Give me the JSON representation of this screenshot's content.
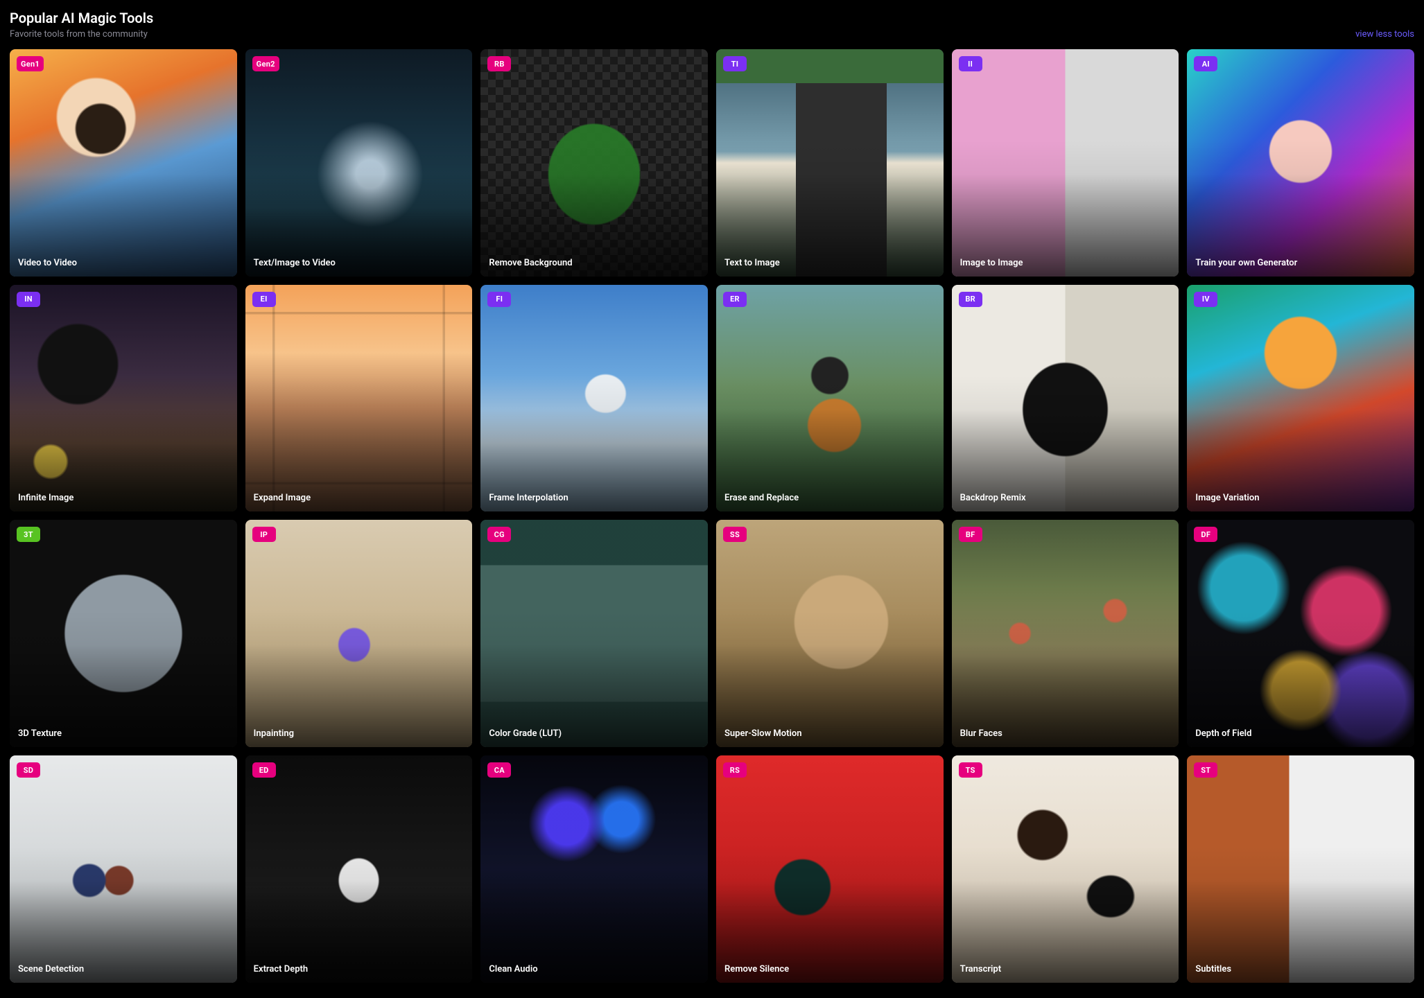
{
  "header": {
    "title": "Popular AI Magic Tools",
    "subtitle": "Favorite tools from the community",
    "toggle_label": "view less tools"
  },
  "badge_colors": {
    "pink": "#e6007e",
    "purple": "#7b2ff2",
    "green": "#58c322"
  },
  "tools": [
    {
      "badge": "Gen1",
      "badge_color": "pink",
      "label": "Video to Video",
      "thumb_class": "t-gen1"
    },
    {
      "badge": "Gen2",
      "badge_color": "pink",
      "label": "Text/Image to Video",
      "thumb_class": "t-gen2"
    },
    {
      "badge": "RB",
      "badge_color": "pink",
      "label": "Remove Background",
      "thumb_class": "t-rb"
    },
    {
      "badge": "TI",
      "badge_color": "purple",
      "label": "Text to Image",
      "thumb_class": "t-ti"
    },
    {
      "badge": "II",
      "badge_color": "purple",
      "label": "Image to Image",
      "thumb_class": "t-ii"
    },
    {
      "badge": "AI",
      "badge_color": "purple",
      "label": "Train your own Generator",
      "thumb_class": "t-ai"
    },
    {
      "badge": "IN",
      "badge_color": "purple",
      "label": "Infinite Image",
      "thumb_class": "t-in"
    },
    {
      "badge": "EI",
      "badge_color": "purple",
      "label": "Expand Image",
      "thumb_class": "t-ei"
    },
    {
      "badge": "FI",
      "badge_color": "purple",
      "label": "Frame Interpolation",
      "thumb_class": "t-fi"
    },
    {
      "badge": "ER",
      "badge_color": "purple",
      "label": "Erase and Replace",
      "thumb_class": "t-er"
    },
    {
      "badge": "BR",
      "badge_color": "purple",
      "label": "Backdrop Remix",
      "thumb_class": "t-br"
    },
    {
      "badge": "IV",
      "badge_color": "purple",
      "label": "Image Variation",
      "thumb_class": "t-iv"
    },
    {
      "badge": "3T",
      "badge_color": "green",
      "label": "3D Texture",
      "thumb_class": "t-3t"
    },
    {
      "badge": "IP",
      "badge_color": "pink",
      "label": "Inpainting",
      "thumb_class": "t-ip"
    },
    {
      "badge": "CG",
      "badge_color": "pink",
      "label": "Color Grade (LUT)",
      "thumb_class": "t-cg"
    },
    {
      "badge": "SS",
      "badge_color": "pink",
      "label": "Super-Slow Motion",
      "thumb_class": "t-ss"
    },
    {
      "badge": "BF",
      "badge_color": "pink",
      "label": "Blur Faces",
      "thumb_class": "t-bf"
    },
    {
      "badge": "DF",
      "badge_color": "pink",
      "label": "Depth of Field",
      "thumb_class": "t-df"
    },
    {
      "badge": "SD",
      "badge_color": "pink",
      "label": "Scene Detection",
      "thumb_class": "t-sd"
    },
    {
      "badge": "ED",
      "badge_color": "pink",
      "label": "Extract Depth",
      "thumb_class": "t-ed"
    },
    {
      "badge": "CA",
      "badge_color": "pink",
      "label": "Clean Audio",
      "thumb_class": "t-ca"
    },
    {
      "badge": "RS",
      "badge_color": "pink",
      "label": "Remove Silence",
      "thumb_class": "t-rs"
    },
    {
      "badge": "TS",
      "badge_color": "pink",
      "label": "Transcript",
      "thumb_class": "t-ts"
    },
    {
      "badge": "ST",
      "badge_color": "pink",
      "label": "Subtitles",
      "thumb_class": "t-st"
    }
  ]
}
